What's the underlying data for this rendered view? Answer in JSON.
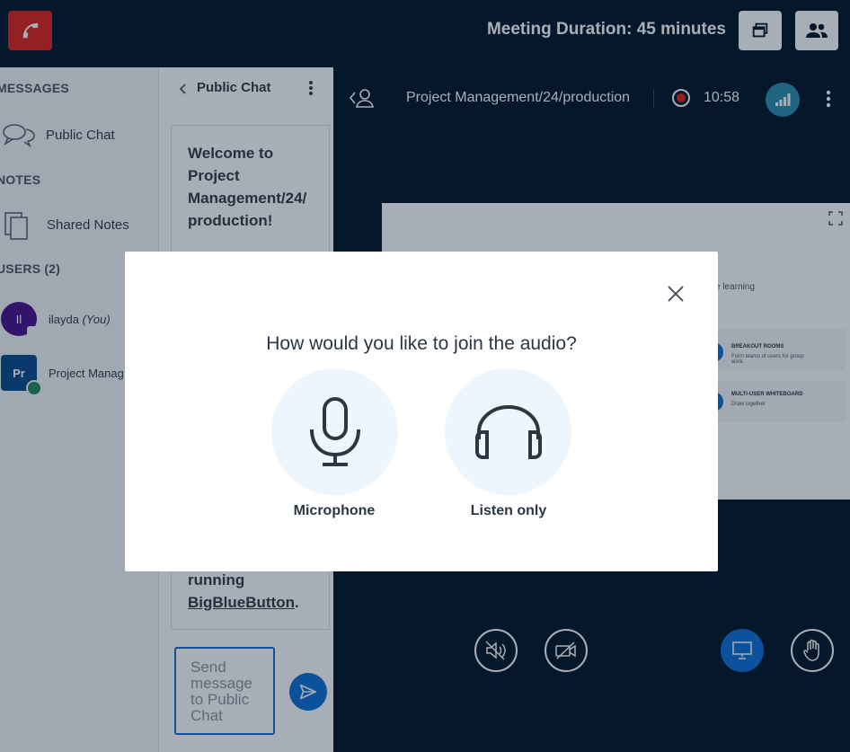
{
  "topbar": {
    "meeting_duration": "Meeting Duration: 45 minutes",
    "leave_icon": "phone-icon",
    "layout_icon": "windows-icon",
    "users_icon": "users-icon"
  },
  "sidebar": {
    "messages_title": "MESSAGES",
    "public_chat": "Public Chat",
    "notes_title": "NOTES",
    "shared_notes": "Shared Notes",
    "users_title": "USERS (2)",
    "users": [
      {
        "initials": "Il",
        "name": "ilayda",
        "you": "(You)"
      },
      {
        "initials": "Pr",
        "name": "Project Manag"
      }
    ]
  },
  "chat": {
    "header": "Public Chat",
    "welcome": "Welcome to Project Management/24/ production!",
    "running_prefix": "running",
    "link": "BigBlueButton",
    "link_suffix": ".",
    "input_placeholder": "Send message to Public Chat"
  },
  "main": {
    "title": "Project Management/24/production",
    "record_time": "10:58"
  },
  "slide": {
    "learning": "e learning",
    "breakout_title": "BREAKOUT ROOMS",
    "breakout_desc": "Form teams of users for group work.",
    "whiteboard_title": "MULTI-USER WHITEBOARD",
    "whiteboard_desc": "Draw together"
  },
  "modal": {
    "title": "How would you like to join the audio?",
    "microphone": "Microphone",
    "listen_only": "Listen only"
  },
  "colors": {
    "navy": "#06172a",
    "leave_red": "#df2721",
    "accent_blue": "#0f70d7"
  }
}
